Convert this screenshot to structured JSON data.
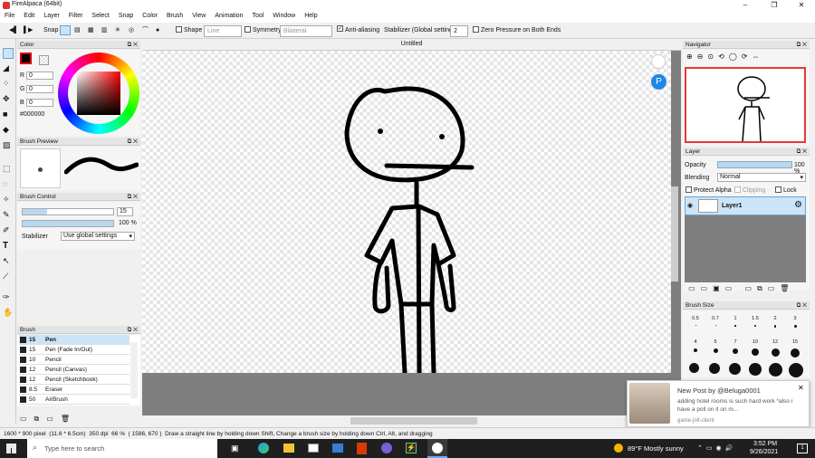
{
  "titlebar": {
    "title": "FireAlpaca (64bit)",
    "minimize": "–",
    "maximize": "❐",
    "close": "✕"
  },
  "menu": [
    "File",
    "Edit",
    "Layer",
    "Filter",
    "Select",
    "Snap",
    "Color",
    "Brush",
    "View",
    "Animation",
    "Tool",
    "Window",
    "Help"
  ],
  "toolbar": {
    "snap": "Snap",
    "shape": "Shape",
    "shape_value": "Line",
    "symmetry": "Symmetry",
    "symmetry_value": "Bilateral",
    "anti_aliasing": "Anti-aliasing",
    "stabilizer": "Stabilizer (Global settings)",
    "stabilizer_value": "2",
    "zero_pressure": "Zero Pressure on Both Ends"
  },
  "document": {
    "tab": "Untitled"
  },
  "color_panel": {
    "title": "Color",
    "r_label": "R",
    "g_label": "G",
    "b_label": "B",
    "r": "0",
    "g": "0",
    "b": "0",
    "hex": "#000000"
  },
  "brush_preview": {
    "title": "Brush Preview"
  },
  "brush_control": {
    "title": "Brush Control",
    "size": "15",
    "opacity": "100 %",
    "stabilizer_label": "Stabilizer",
    "stabilizer_value": "Use global settings",
    "size_fraction": 0.27,
    "opacity_fraction": 1.0
  },
  "brush_panel": {
    "title": "Brush",
    "items": [
      {
        "size": "15",
        "name": "Pen",
        "selected": true
      },
      {
        "size": "15",
        "name": "Pen (Fade In/Out)",
        "selected": false
      },
      {
        "size": "10",
        "name": "Pencil",
        "selected": false
      },
      {
        "size": "12",
        "name": "Pencil (Canvas)",
        "selected": false
      },
      {
        "size": "12",
        "name": "Pencil (Sketchbook)",
        "selected": false
      },
      {
        "size": "8.5",
        "name": "Eraser",
        "selected": false
      },
      {
        "size": "50",
        "name": "AirBrush",
        "selected": false
      }
    ]
  },
  "navigator": {
    "title": "Navigator"
  },
  "layer_panel": {
    "title": "Layer",
    "opacity_label": "Opacity",
    "opacity": "100 %",
    "blending_label": "Blending",
    "blending": "Normal",
    "protect_alpha": "Protect Alpha",
    "clipping": "Clipping",
    "lock": "Lock",
    "layer_name": "Layer1"
  },
  "brush_size_panel": {
    "title": "Brush Size",
    "sizes": [
      "0.5",
      "0.7",
      "1",
      "1.5",
      "2",
      "3",
      "4",
      "5",
      "7",
      "10",
      "12",
      "15"
    ]
  },
  "statusbar": {
    "dims": "1600 * 900 pixel",
    "cm": "(11.6 * 6.5cm)",
    "dpi": "350 dpi",
    "zoom": "66 %",
    "coord": "( 1586, 670 )",
    "hint": "Draw a straight line by holding down Shift, Change a brush size by holding down Ctrl, Alt, and dragging"
  },
  "notification": {
    "title": "New Post by @Beluga0001",
    "body": "adding hotel rooms is such hard work *also i have a poll on it on m...",
    "source": "game-jolt-client",
    "close": "✕"
  },
  "taskbar": {
    "search_placeholder": "Type here to search",
    "weather": "89°F  Mostly sunny",
    "time": "3:52 PM",
    "date": "9/26/2021",
    "notif_count": "1"
  }
}
